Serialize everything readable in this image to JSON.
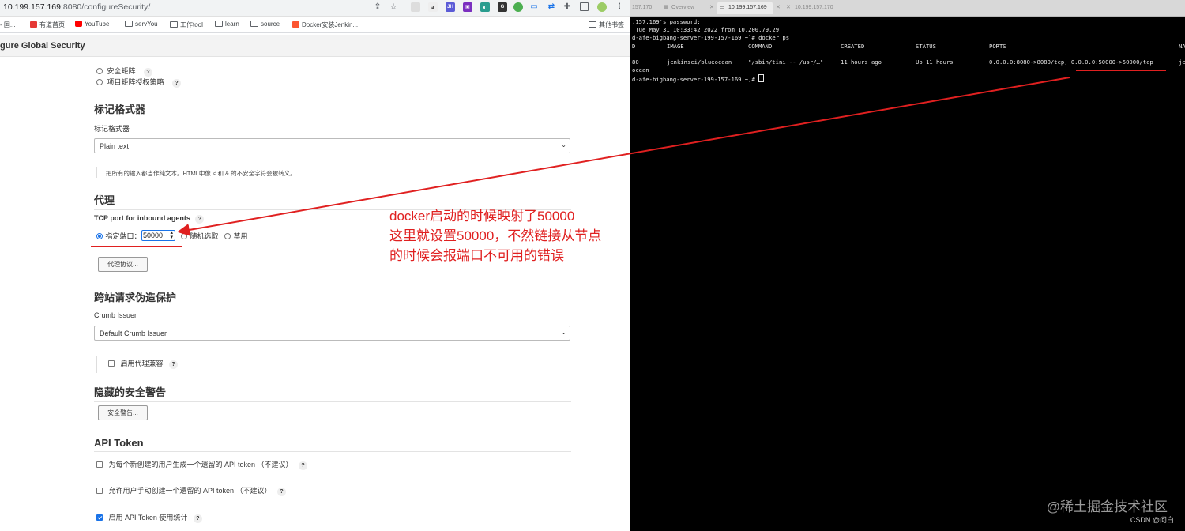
{
  "browser": {
    "url_host": "10.199.157.169",
    "url_path": ":8080/configureSecurity/",
    "bookmarks": [
      {
        "label": "- 国...",
        "icon": "bookmark-generic-icon"
      },
      {
        "label": "有道首页",
        "icon": "youdao-icon"
      },
      {
        "label": "YouTube",
        "icon": "youtube-icon"
      },
      {
        "label": "servYou",
        "icon": "folder-icon"
      },
      {
        "label": "工作tool",
        "icon": "folder-icon"
      },
      {
        "label": "learn",
        "icon": "folder-icon"
      },
      {
        "label": "source",
        "icon": "folder-icon"
      },
      {
        "label": "Docker安装Jenkin...",
        "icon": "csdn-icon"
      }
    ],
    "other_bookmarks": "其他书签",
    "page_title": "gure Global Security"
  },
  "auth": {
    "matrix": "安全矩阵",
    "project_matrix": "项目矩阵授权策略"
  },
  "markup": {
    "section": "标记格式器",
    "label": "标记格式器",
    "value": "Plain text",
    "help": "把所有的输入都当作纯文本。HTML中像 < 和 & 的不安全字符会被转义。"
  },
  "agents": {
    "section": "代理",
    "tcp_label": "TCP port for inbound agents",
    "fixed_label": "指定端口：",
    "port_value": "50000",
    "random_label": "随机选取",
    "disable_label": "禁用",
    "protocols_button": "代理协议..."
  },
  "csrf": {
    "section": "跨站请求伪造保护",
    "label": "Crumb Issuer",
    "value": "Default Crumb Issuer",
    "proxy_compat": "启用代理兼容"
  },
  "warnings": {
    "section": "隐藏的安全警告",
    "button": "安全警告..."
  },
  "api": {
    "section": "API Token",
    "legacy_auto": "为每个新创建的用户生成一个遗留的 API token （不建议）",
    "legacy_manual": "允许用户手动创建一个遗留的 API token （不建议）",
    "usage_stats": "启用 API Token 使用统计"
  },
  "annotation": {
    "line1": "docker启动的时候映射了50000",
    "line2": "这里就设置50000，不然链接从节点",
    "line3": "的时候会报端口不可用的错误",
    "color": "#e02020"
  },
  "terminal": {
    "tabs": [
      "157.170",
      "Overview",
      "10.199.157.169",
      "10.199.157.170"
    ],
    "line_password": ".157.169's password:",
    "line_last_login": " Tue May 31 10:33:42 2022 from 10.200.79.29",
    "line_cmd": "d-afe-bigbang-server-199-157-169 ~]# docker ps",
    "headers": {
      "id": "D",
      "image": "IMAGE",
      "command": "COMMAND",
      "created": "CREATED",
      "status": "STATUS",
      "ports": "PORTS",
      "names": "NA"
    },
    "row": {
      "id": "80",
      "image": "jenkinsci/blueocean",
      "command": "\"/sbin/tini -- /usr/…\"",
      "created": "11 hours ago",
      "status": "Up 11 hours",
      "ports": "0.0.0.0:8080->8080/tcp, 0.0.0.0:50000->50000/tcp",
      "names": "je"
    },
    "line_wrap": "ocean",
    "line_prompt": "d-afe-bigbang-server-199-157-169 ~]# "
  },
  "watermark": "@稀土掘金技术社区",
  "credit": "CSDN @问白"
}
